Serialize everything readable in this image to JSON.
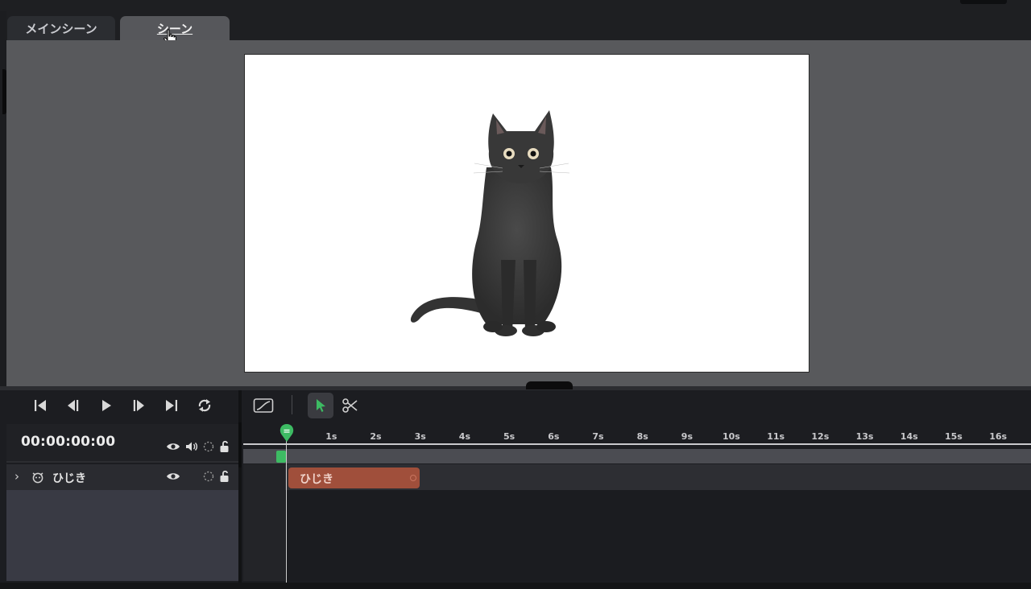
{
  "tabs": [
    {
      "label": "メインシーン",
      "active": false
    },
    {
      "label": "シーン",
      "active": true
    }
  ],
  "playback": {
    "timecode": "00:00:00:00",
    "controls": [
      "skip-to-start-icon",
      "step-back-icon",
      "play-icon",
      "step-forward-icon",
      "skip-to-end-icon",
      "loop-icon"
    ]
  },
  "tools": [
    "curve-editor-icon",
    "select-arrow-icon",
    "scissors-icon"
  ],
  "ruler": {
    "ticks": [
      "1s",
      "2s",
      "3s",
      "4s",
      "5s",
      "6s",
      "7s",
      "8s",
      "9s",
      "10s",
      "11s",
      "12s",
      "13s",
      "14s",
      "15s",
      "16s"
    ]
  },
  "tracks": [
    {
      "name": "ひじき",
      "clip_label": "ひじき",
      "expanded": false
    }
  ],
  "colors": {
    "accent_green": "#3dbb63",
    "clip": "#a04f3b",
    "preview_bg": "#58595c"
  }
}
